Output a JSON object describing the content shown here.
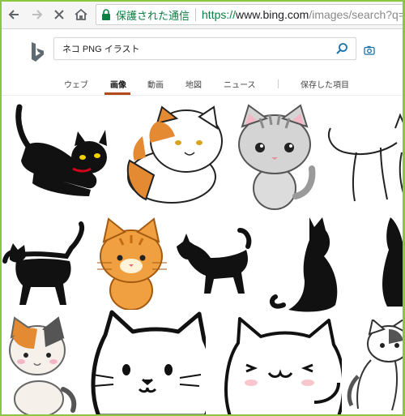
{
  "browser": {
    "secure_label": "保護された通信",
    "url_protocol": "https://",
    "url_host": "www.bing.com",
    "url_path": "/images/search?q="
  },
  "search": {
    "query": "ネコ PNG イラスト"
  },
  "tabs": [
    {
      "label": "ウェブ",
      "active": false
    },
    {
      "label": "画像",
      "active": true
    },
    {
      "label": "動画",
      "active": false
    },
    {
      "label": "地図",
      "active": false
    },
    {
      "label": "ニュース",
      "active": false
    },
    {
      "label": "保存した項目",
      "active": false
    }
  ],
  "images": [
    {
      "name": "black-cat-stretching"
    },
    {
      "name": "calico-cat-sitting"
    },
    {
      "name": "gray-tabby-kitten"
    },
    {
      "name": "white-cat-outline"
    },
    {
      "name": "black-cat-silhouette-walking"
    },
    {
      "name": "orange-tabby-cat"
    },
    {
      "name": "black-cat-silhouette-stretch"
    },
    {
      "name": "black-cat-silhouette-sitting"
    },
    {
      "name": "black-cat-silhouette-partial"
    },
    {
      "name": "calico-cat-crouching"
    },
    {
      "name": "white-cat-face-closeup"
    },
    {
      "name": "white-cat-smiling"
    },
    {
      "name": "white-cat-standing"
    }
  ],
  "colors": {
    "accent_underline": "#b44a1a",
    "secure_green": "#0b8043",
    "frame_green": "#8cc63f"
  }
}
